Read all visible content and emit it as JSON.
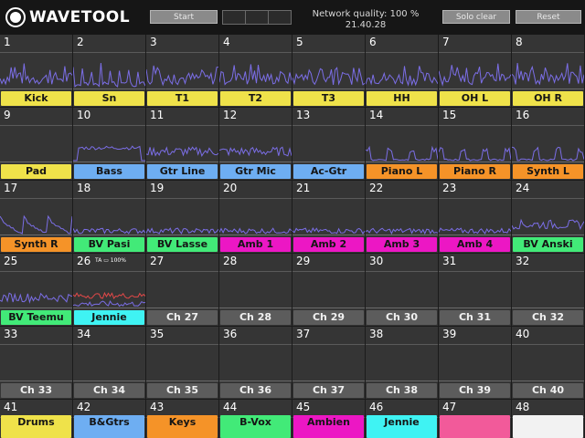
{
  "app": {
    "logo_text": "WAVETOOL",
    "start_label": "Start",
    "network_quality": "Network quality: 100 %",
    "time": "21.40.28",
    "solo_clear_label": "Solo clear",
    "reset_label": "Reset"
  },
  "colors": {
    "yellow": "#efe24a",
    "blue": "#6eaef2",
    "orange": "#f59328",
    "green": "#42ea78",
    "magenta": "#ec17c4",
    "cyan": "#3ff3f3",
    "gray": "#5c5c5c",
    "pink": "#f25a9a",
    "light": "#f2f2f2",
    "wave": "#7b6ee6",
    "wave_red": "#e24848"
  },
  "channels": [
    {
      "num": "1",
      "name": "Kick",
      "color": "yellow",
      "activity": "dense"
    },
    {
      "num": "2",
      "name": "Sn",
      "color": "yellow",
      "activity": "spiky"
    },
    {
      "num": "3",
      "name": "T1",
      "color": "yellow",
      "activity": "dense"
    },
    {
      "num": "4",
      "name": "T2",
      "color": "yellow",
      "activity": "dense"
    },
    {
      "num": "5",
      "name": "T3",
      "color": "yellow",
      "activity": "dense"
    },
    {
      "num": "6",
      "name": "HH",
      "color": "yellow",
      "activity": "dense"
    },
    {
      "num": "7",
      "name": "OH L",
      "color": "yellow",
      "activity": "dense"
    },
    {
      "num": "8",
      "name": "OH R",
      "color": "yellow",
      "activity": "dense"
    },
    {
      "num": "9",
      "name": "Pad",
      "color": "yellow",
      "activity": "none"
    },
    {
      "num": "10",
      "name": "Bass",
      "color": "blue",
      "activity": "plateau"
    },
    {
      "num": "11",
      "name": "Gtr Line",
      "color": "blue",
      "activity": "mid"
    },
    {
      "num": "12",
      "name": "Gtr Mic",
      "color": "blue",
      "activity": "mid"
    },
    {
      "num": "13",
      "name": "Ac-Gtr",
      "color": "blue",
      "activity": "none"
    },
    {
      "num": "14",
      "name": "Piano L",
      "color": "orange",
      "activity": "bumps"
    },
    {
      "num": "15",
      "name": "Piano R",
      "color": "orange",
      "activity": "bumps"
    },
    {
      "num": "16",
      "name": "Synth L",
      "color": "orange",
      "activity": "bumps"
    },
    {
      "num": "17",
      "name": "Synth R",
      "color": "orange",
      "activity": "decay"
    },
    {
      "num": "18",
      "name": "BV Pasi",
      "color": "green",
      "activity": "low"
    },
    {
      "num": "19",
      "name": "BV Lasse",
      "color": "green",
      "activity": "low"
    },
    {
      "num": "20",
      "name": "Amb 1",
      "color": "magenta",
      "activity": "low"
    },
    {
      "num": "21",
      "name": "Amb 2",
      "color": "magenta",
      "activity": "low"
    },
    {
      "num": "22",
      "name": "Amb 3",
      "color": "magenta",
      "activity": "low"
    },
    {
      "num": "23",
      "name": "Amb 4",
      "color": "magenta",
      "activity": "low"
    },
    {
      "num": "24",
      "name": "BV Anski",
      "color": "green",
      "activity": "mid"
    },
    {
      "num": "25",
      "name": "BV Teemu",
      "color": "green",
      "activity": "mid"
    },
    {
      "num": "26",
      "name": "Jennie",
      "color": "cyan",
      "activity": "red",
      "badge": "TA",
      "battery": "100%"
    },
    {
      "num": "27",
      "name": "Ch 27",
      "color": "gray",
      "activity": "none"
    },
    {
      "num": "28",
      "name": "Ch 28",
      "color": "gray",
      "activity": "none"
    },
    {
      "num": "29",
      "name": "Ch 29",
      "color": "gray",
      "activity": "none"
    },
    {
      "num": "30",
      "name": "Ch 30",
      "color": "gray",
      "activity": "none"
    },
    {
      "num": "31",
      "name": "Ch 31",
      "color": "gray",
      "activity": "none"
    },
    {
      "num": "32",
      "name": "Ch 32",
      "color": "gray",
      "activity": "none"
    },
    {
      "num": "33",
      "name": "Ch 33",
      "color": "gray",
      "activity": "none"
    },
    {
      "num": "34",
      "name": "Ch 34",
      "color": "gray",
      "activity": "none"
    },
    {
      "num": "35",
      "name": "Ch 35",
      "color": "gray",
      "activity": "none"
    },
    {
      "num": "36",
      "name": "Ch 36",
      "color": "gray",
      "activity": "none"
    },
    {
      "num": "37",
      "name": "Ch 37",
      "color": "gray",
      "activity": "none"
    },
    {
      "num": "38",
      "name": "Ch 38",
      "color": "gray",
      "activity": "none"
    },
    {
      "num": "39",
      "name": "Ch 39",
      "color": "gray",
      "activity": "none"
    },
    {
      "num": "40",
      "name": "Ch 40",
      "color": "gray",
      "activity": "none"
    },
    {
      "num": "41",
      "name": "Drums",
      "color": "yellow",
      "activity": "none"
    },
    {
      "num": "42",
      "name": "B&Gtrs",
      "color": "blue",
      "activity": "none"
    },
    {
      "num": "43",
      "name": "Keys",
      "color": "orange",
      "activity": "none"
    },
    {
      "num": "44",
      "name": "B-Vox",
      "color": "green",
      "activity": "none"
    },
    {
      "num": "45",
      "name": "Ambien",
      "color": "magenta",
      "activity": "none"
    },
    {
      "num": "46",
      "name": "Jennie",
      "color": "cyan",
      "activity": "none"
    },
    {
      "num": "47",
      "name": "",
      "color": "pink",
      "activity": "none"
    },
    {
      "num": "48",
      "name": "",
      "color": "light",
      "activity": "none"
    }
  ]
}
